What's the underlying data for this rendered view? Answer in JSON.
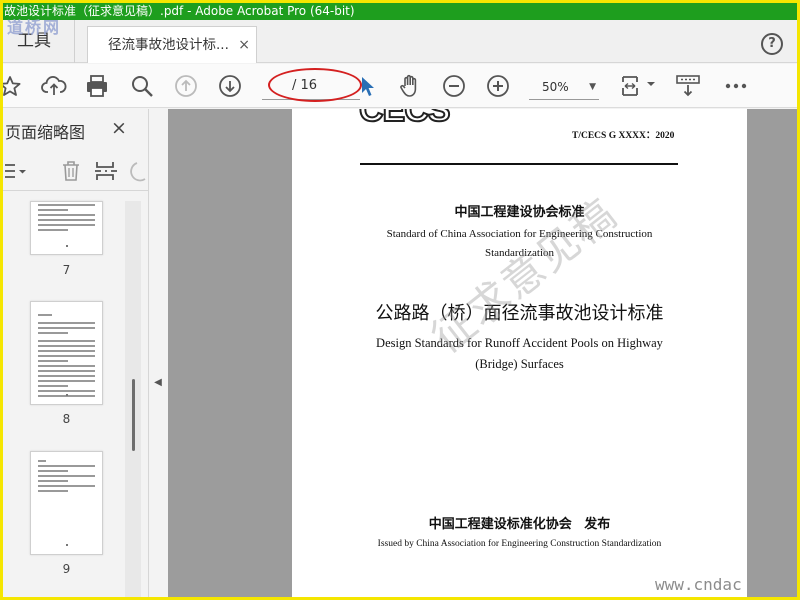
{
  "window": {
    "title": "故池设计标准（征求意见稿）.pdf - Adobe Acrobat Pro (64-bit)"
  },
  "tabs": {
    "tools_label": "工具",
    "document_tab_label": "径流事故池设计标...",
    "close_glyph": "×",
    "help_glyph": "?"
  },
  "toolbar": {
    "page_input": "/ 16",
    "zoom_value": "50%",
    "icons": [
      "bookmark-star-icon",
      "upload-cloud-icon",
      "print-icon",
      "zoom-search-icon",
      "prev-page-icon",
      "next-page-icon",
      "select-cursor-icon",
      "hand-tool-icon",
      "zoom-out-icon",
      "zoom-in-icon",
      "fit-page-icon",
      "scroll-mode-icon",
      "more-tools-icon"
    ]
  },
  "sidebar": {
    "title": "页面缩略图",
    "close_glyph": "×",
    "thumbnails": [
      {
        "label": "7"
      },
      {
        "label": "8"
      },
      {
        "label": "9"
      }
    ]
  },
  "document": {
    "logo": "CECS",
    "code": "T/CECS G XXXX：2020",
    "association_cn": "中国工程建设协会标准",
    "association_en": "Standard of China Association for Engineering Construction Standardization",
    "title_cn": "公路路（桥）面径流事故池设计标准",
    "title_en": "Design Standards for Runoff Accident Pools on Highway (Bridge) Surfaces",
    "watermark": "征求意见稿",
    "issuer_cn": "中国工程建设标准化协会 发布",
    "issuer_en": "Issued by China Association for Engineering Construction Standardization"
  },
  "overlays": {
    "site_logo": "道桥网",
    "site_url": "www.cndac"
  },
  "colors": {
    "titlebar": "#1e9e1e",
    "annotation_ellipse": "#d42020",
    "border_highlight": "#f5e600"
  }
}
